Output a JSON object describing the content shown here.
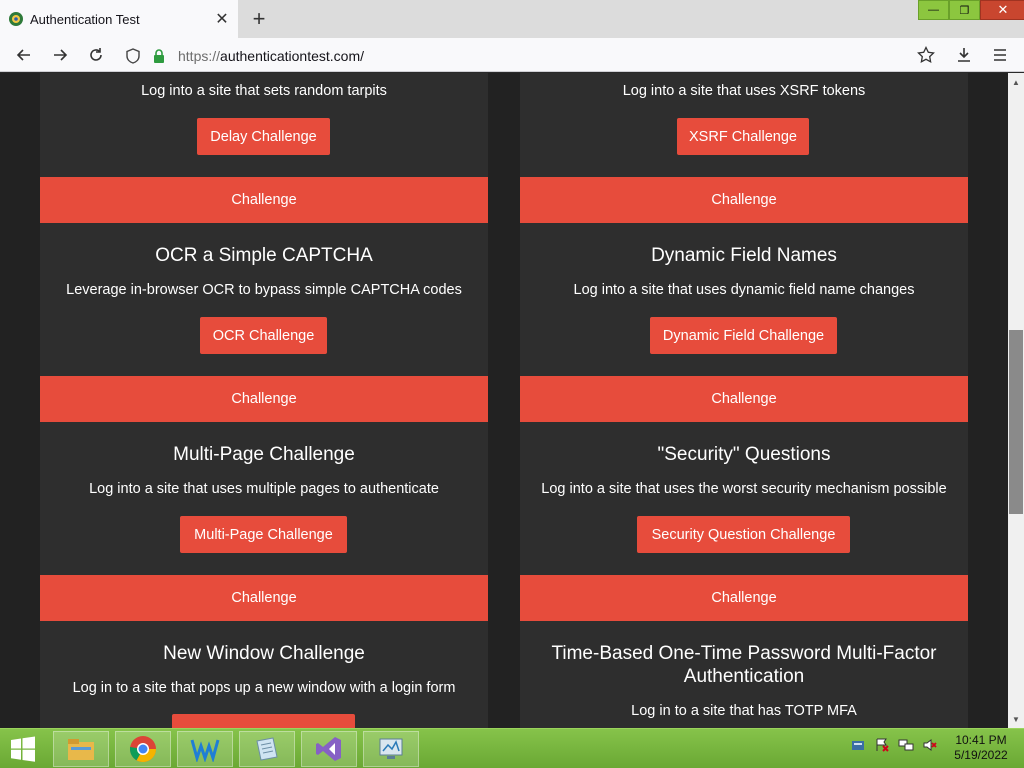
{
  "browser": {
    "tab_title": "Authentication Test",
    "url_protocol": "https://",
    "url_host": "authenticationtest.com/",
    "icons": {
      "favicon": "site-favicon",
      "tab_close": "close-icon",
      "new_tab": "plus-icon",
      "back": "back-arrow-icon",
      "forward": "forward-arrow-icon",
      "reload": "reload-icon",
      "shield": "shield-icon",
      "lock": "lock-icon",
      "bookmark": "star-icon",
      "downloads": "download-icon",
      "menu": "hamburger-menu-icon"
    }
  },
  "theme": {
    "accent": "#e74c3c",
    "card_bg": "#2e2e2e",
    "page_bg": "#222222",
    "taskbar": "#7ab83f"
  },
  "cards": {
    "delay": {
      "desc": "Log into a site that sets random tarpits",
      "button": "Delay Challenge"
    },
    "xsrf": {
      "desc": "Log into a site that uses XSRF tokens",
      "button": "XSRF Challenge"
    },
    "ocr": {
      "title": "OCR a Simple CAPTCHA",
      "desc": "Leverage in-browser OCR to bypass simple CAPTCHA codes",
      "button": "OCR Challenge"
    },
    "dynamic": {
      "title": "Dynamic Field Names",
      "desc": "Log into a site that uses dynamic field name changes",
      "button": "Dynamic Field Challenge"
    },
    "multipage": {
      "title": "Multi-Page Challenge",
      "desc": "Log into a site that uses multiple pages to authenticate",
      "button": "Multi-Page Challenge"
    },
    "security": {
      "title": "\"Security\" Questions",
      "desc": "Log into a site that uses the worst security mechanism possible",
      "button": "Security Question Challenge"
    },
    "newwindow": {
      "title": "New Window Challenge",
      "desc": "Log in to a site that pops up a new window with a login form"
    },
    "totp": {
      "title_line1": "Time-Based One-Time Password Multi-Factor",
      "title_line2": "Authentication",
      "desc": "Log in to a site that has TOTP MFA"
    }
  },
  "banner_label": "Challenge",
  "taskbar": {
    "apps": [
      "file-explorer-icon",
      "chrome-icon",
      "wireshark-icon",
      "notepad-icon",
      "visual-studio-icon",
      "control-panel-icon"
    ],
    "tray": [
      "keyboard-icon",
      "flag-icon",
      "network-icon",
      "volume-muted-icon"
    ],
    "time": "10:41 PM",
    "date": "5/19/2022"
  }
}
